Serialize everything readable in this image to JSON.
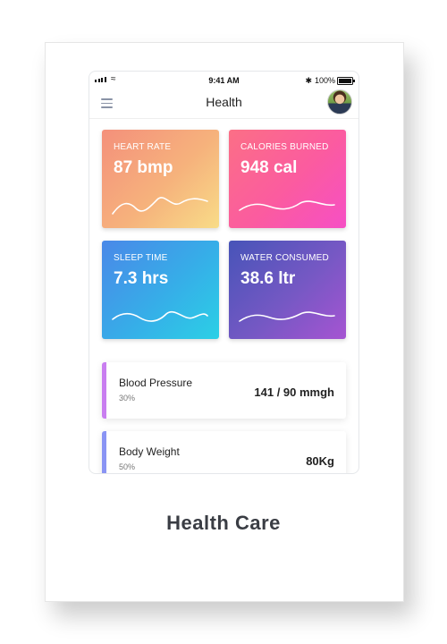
{
  "status_bar": {
    "time": "9:41 AM",
    "battery_text": "100%",
    "bluetooth_icon": "bluetooth-icon",
    "wifi_icon": "wifi-icon"
  },
  "header": {
    "title": "Health",
    "menu_icon": "hamburger-menu-icon",
    "avatar_icon": "user-avatar"
  },
  "tiles": [
    {
      "label": "HEART RATE",
      "value": "87 bmp",
      "gradient": [
        "#f4907b",
        "#f8dc88"
      ]
    },
    {
      "label": "CALORIES BURNED",
      "value": "948 cal",
      "gradient": [
        "#fb6f86",
        "#f64fc5"
      ]
    },
    {
      "label": "SLEEP TIME",
      "value": "7.3 hrs",
      "gradient": [
        "#4a88e8",
        "#2bd0e6"
      ]
    },
    {
      "label": "WATER CONSUMED",
      "value": "38.6 ltr",
      "gradient": [
        "#4754b8",
        "#a654d2"
      ]
    }
  ],
  "stats": [
    {
      "name": "Blood Pressure",
      "percent": "30%",
      "reading": "141 / 90 mmgh",
      "accent": "#c97ef0"
    },
    {
      "name": "Body Weight",
      "percent": "50%",
      "reading": "80Kg",
      "accent": "#8a94f4"
    }
  ],
  "caption": "Health Care"
}
